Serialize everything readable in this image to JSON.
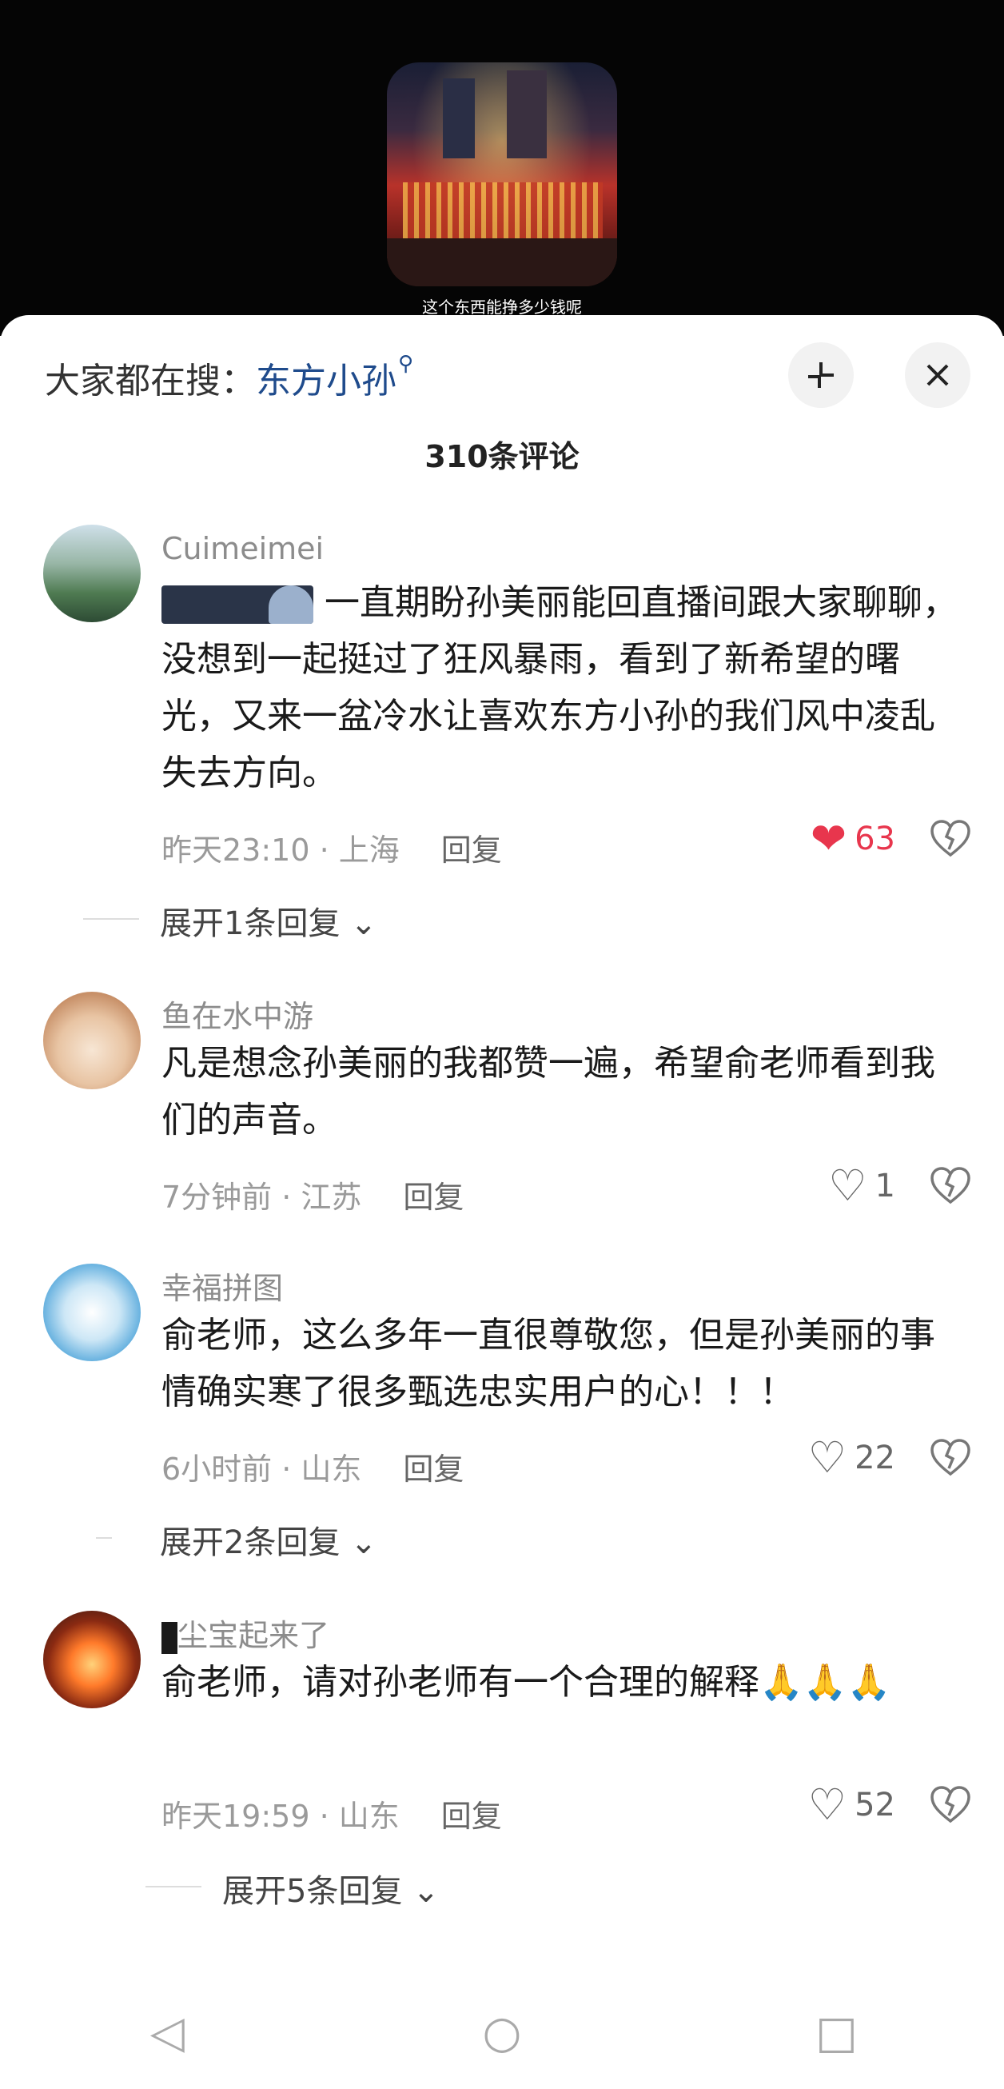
{
  "video": {
    "caption": "这个东西能挣多少钱呢"
  },
  "header": {
    "search_prefix": "大家都在搜：",
    "search_keyword": "东方小孙",
    "search_icon": "magnifier-icon",
    "collapse_icon": "collapse-icon",
    "close_icon": "close-icon"
  },
  "comment_count": "310条评论",
  "comments": [
    {
      "username": "Cuimeimei",
      "text": "一直期盼孙美丽能回直播间跟大家聊聊，没想到一起挺过了狂风暴雨，看到了新希望的曙光，又来一盆冷水让喜欢东方小孙的我们风中凌乱失去方向。",
      "time": "昨天23:10 · 上海",
      "reply": "回复",
      "likes": "63",
      "liked": true,
      "expand": "展开1条回复"
    },
    {
      "username": "鱼在水中游",
      "text": "凡是想念孙美丽的我都赞一遍，希望俞老师看到我们的声音。",
      "time": "7分钟前 · 江苏",
      "reply": "回复",
      "likes": "1",
      "liked": false
    },
    {
      "username": "幸福拼图",
      "text": "俞老师，这么多年一直很尊敬您，但是孙美丽的事情确实寒了很多甄选忠实用户的心！！！",
      "time": "6小时前 · 山东",
      "reply": "回复",
      "likes": "22",
      "liked": false,
      "expand": "展开2条回复"
    },
    {
      "username": "尘宝起来了",
      "text": "俞老师，请对孙老师有一个合理的解释🙏🙏🙏",
      "time": "昨天19:59 · 山东",
      "reply": "回复",
      "likes": "52",
      "liked": false,
      "expand": "展开5条回复"
    }
  ],
  "navbar": [
    "back-icon",
    "home-icon",
    "recents-icon"
  ]
}
